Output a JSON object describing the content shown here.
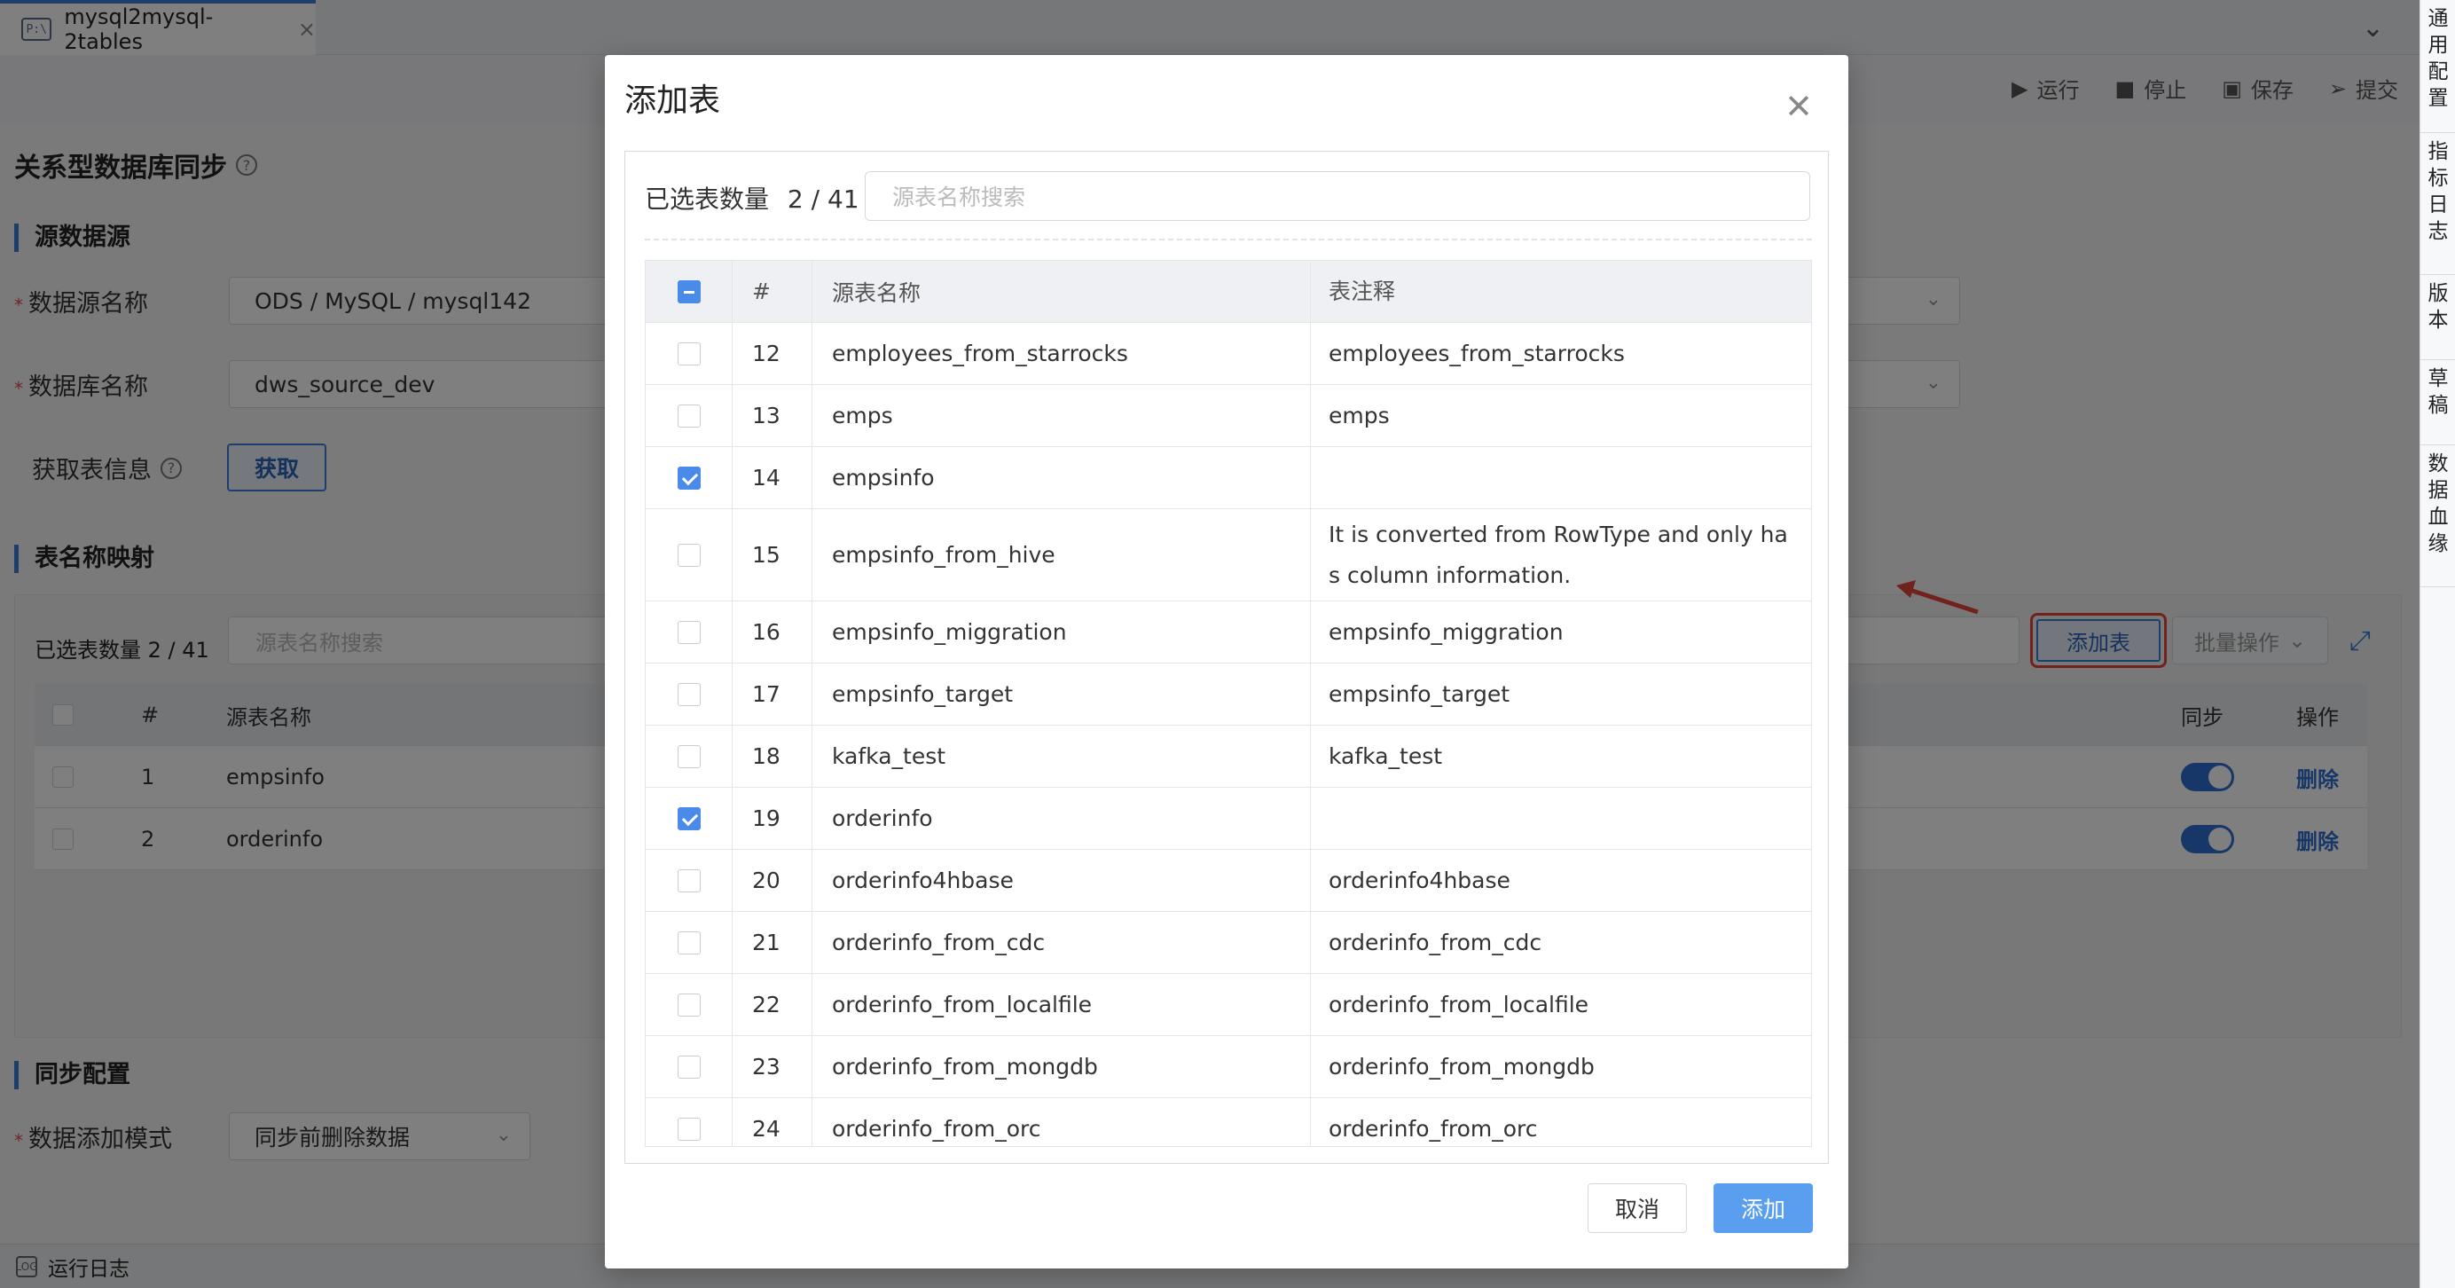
{
  "tab": {
    "icon_text": "P:\\",
    "label": "mysql2mysql-2tables",
    "close": "×"
  },
  "collapse_icon": "chevron-double-down-icon",
  "right_panel": [
    "通用配置",
    "指标日志",
    "版本",
    "草稿",
    "数据血缘"
  ],
  "toolbar": {
    "run": "运行",
    "stop": "停止",
    "save": "保存",
    "submit": "提交"
  },
  "page_title": "关系型数据库同步",
  "source_section": {
    "title": "源数据源",
    "datasource_label": "数据源名称",
    "datasource_value": "ODS / MySQL / mysql142",
    "database_label": "数据库名称",
    "database_value": "dws_source_dev",
    "table_info_label": "获取表信息",
    "fetch_button": "获取"
  },
  "mapping_section": {
    "title": "表名称映射",
    "count": "已选表数量 2 / 41",
    "search_placeholder": "源表名称搜索",
    "add_table_button": "添加表",
    "batch_button": "批量操作",
    "headers": {
      "num": "#",
      "name": "源表名称",
      "sync": "同步",
      "action": "操作"
    },
    "rows": [
      {
        "num": "1",
        "name": "empsinfo",
        "action": "删除"
      },
      {
        "num": "2",
        "name": "orderinfo",
        "action": "删除"
      }
    ]
  },
  "sync_section": {
    "title": "同步配置",
    "mode_label": "数据添加模式",
    "mode_value": "同步前删除数据"
  },
  "statusbar": {
    "label": "运行日志"
  },
  "modal": {
    "title": "添加表",
    "count_label": "已选表数量",
    "count": "2 / 41",
    "search_placeholder": "源表名称搜索",
    "headers": {
      "num": "#",
      "name": "源表名称",
      "comment": "表注释"
    },
    "rows": [
      {
        "num": "12",
        "name": "employees_from_starrocks",
        "comment": "employees_from_starrocks",
        "checked": false
      },
      {
        "num": "13",
        "name": "emps",
        "comment": "emps",
        "checked": false
      },
      {
        "num": "14",
        "name": "empsinfo",
        "comment": "",
        "checked": true
      },
      {
        "num": "15",
        "name": "empsinfo_from_hive",
        "comment": "It is converted from RowType and only has column information.",
        "checked": false
      },
      {
        "num": "16",
        "name": "empsinfo_miggration",
        "comment": "empsinfo_miggration",
        "checked": false
      },
      {
        "num": "17",
        "name": "empsinfo_target",
        "comment": "empsinfo_target",
        "checked": false
      },
      {
        "num": "18",
        "name": "kafka_test",
        "comment": "kafka_test",
        "checked": false
      },
      {
        "num": "19",
        "name": "orderinfo",
        "comment": "",
        "checked": true
      },
      {
        "num": "20",
        "name": "orderinfo4hbase",
        "comment": "orderinfo4hbase",
        "checked": false
      },
      {
        "num": "21",
        "name": "orderinfo_from_cdc",
        "comment": "orderinfo_from_cdc",
        "checked": false
      },
      {
        "num": "22",
        "name": "orderinfo_from_localfile",
        "comment": "orderinfo_from_localfile",
        "checked": false
      },
      {
        "num": "23",
        "name": "orderinfo_from_mongdb",
        "comment": "orderinfo_from_mongdb",
        "checked": false
      },
      {
        "num": "24",
        "name": "orderinfo_from_orc",
        "comment": "orderinfo_from_orc",
        "checked": false
      }
    ],
    "cancel_button": "取消",
    "add_button": "添加"
  },
  "colors": {
    "accent": "#3a7bd5",
    "primary_button": "#5a9ef0",
    "annotation": "#e5443a"
  }
}
